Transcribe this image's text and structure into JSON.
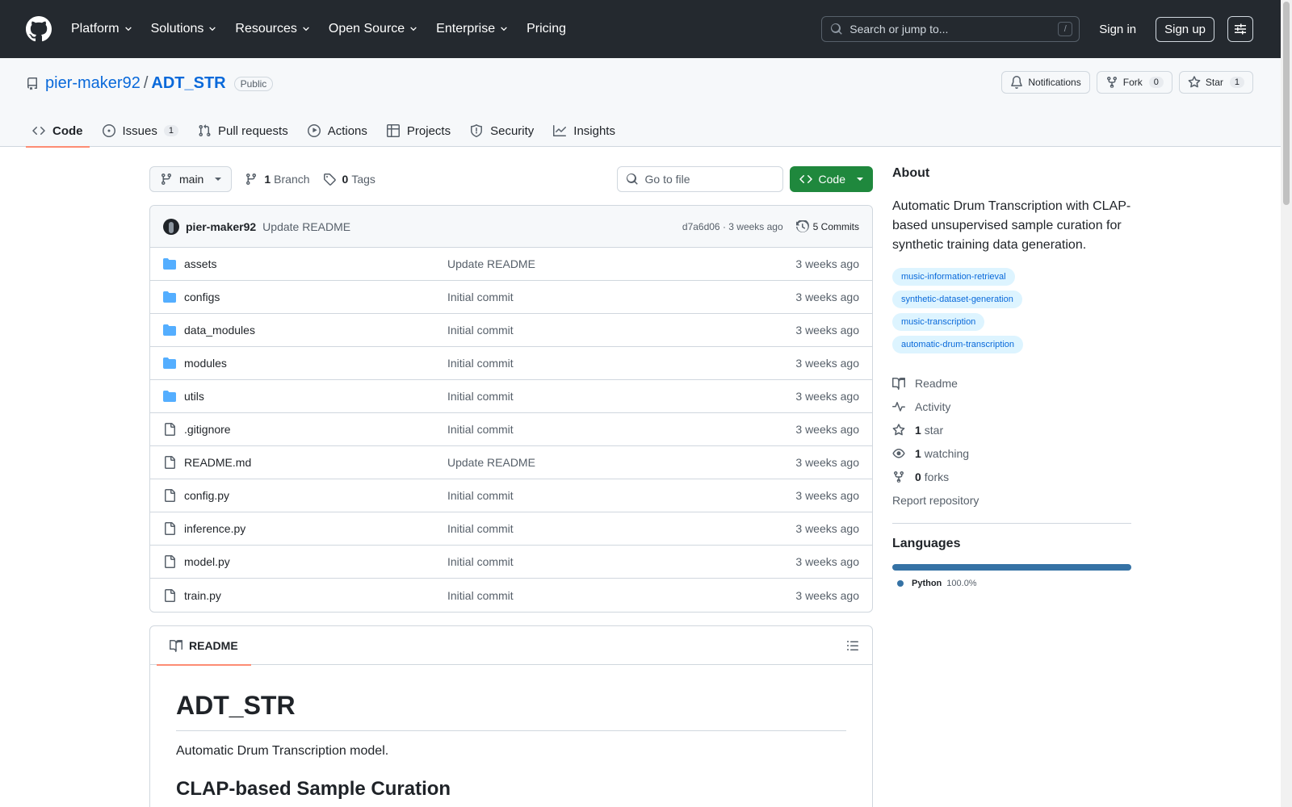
{
  "header": {
    "nav": [
      "Platform",
      "Solutions",
      "Resources",
      "Open Source",
      "Enterprise",
      "Pricing"
    ],
    "search_placeholder": "Search or jump to...",
    "search_shortcut": "/",
    "signin": "Sign in",
    "signup": "Sign up"
  },
  "repo": {
    "owner": "pier-maker92",
    "separator": "/",
    "name": "ADT_STR",
    "visibility": "Public",
    "notifications": "Notifications",
    "fork_label": "Fork",
    "fork_count": "0",
    "star_label": "Star",
    "star_count": "1"
  },
  "tabs": [
    {
      "label": "Code",
      "icon": "code-icon",
      "active": true
    },
    {
      "label": "Issues",
      "icon": "issue-icon",
      "count": "1"
    },
    {
      "label": "Pull requests",
      "icon": "pull-request-icon"
    },
    {
      "label": "Actions",
      "icon": "play-icon"
    },
    {
      "label": "Projects",
      "icon": "table-icon"
    },
    {
      "label": "Security",
      "icon": "shield-icon"
    },
    {
      "label": "Insights",
      "icon": "graph-icon"
    }
  ],
  "filebar": {
    "branch": "main",
    "branch_count": "1",
    "branch_label": "Branch",
    "tag_count": "0",
    "tag_label": "Tags",
    "goto_placeholder": "Go to file",
    "code_button": "Code"
  },
  "latest_commit": {
    "author": "pier-maker92",
    "message": "Update README",
    "meta": "d7a6d06 · 3 weeks ago",
    "commits": "5 Commits"
  },
  "files": [
    {
      "name": "assets",
      "type": "dir",
      "message": "Update README",
      "date": "3 weeks ago"
    },
    {
      "name": "configs",
      "type": "dir",
      "message": "Initial commit",
      "date": "3 weeks ago"
    },
    {
      "name": "data_modules",
      "type": "dir",
      "message": "Initial commit",
      "date": "3 weeks ago"
    },
    {
      "name": "modules",
      "type": "dir",
      "message": "Initial commit",
      "date": "3 weeks ago"
    },
    {
      "name": "utils",
      "type": "dir",
      "message": "Initial commit",
      "date": "3 weeks ago"
    },
    {
      "name": ".gitignore",
      "type": "file",
      "message": "Initial commit",
      "date": "3 weeks ago"
    },
    {
      "name": "README.md",
      "type": "file",
      "message": "Update README",
      "date": "3 weeks ago"
    },
    {
      "name": "config.py",
      "type": "file",
      "message": "Initial commit",
      "date": "3 weeks ago"
    },
    {
      "name": "inference.py",
      "type": "file",
      "message": "Initial commit",
      "date": "3 weeks ago"
    },
    {
      "name": "model.py",
      "type": "file",
      "message": "Initial commit",
      "date": "3 weeks ago"
    },
    {
      "name": "train.py",
      "type": "file",
      "message": "Initial commit",
      "date": "3 weeks ago"
    }
  ],
  "readme": {
    "tab": "README",
    "h1": "ADT_STR",
    "p": "Automatic Drum Transcription model.",
    "h2": "CLAP-based Sample Curation"
  },
  "about": {
    "title": "About",
    "description": "Automatic Drum Transcription with CLAP-based unsupervised sample curation for synthetic training data generation.",
    "topics": [
      "music-information-retrieval",
      "synthetic-dataset-generation",
      "music-transcription",
      "automatic-drum-transcription"
    ],
    "readme": "Readme",
    "activity": "Activity",
    "stars_count": "1",
    "stars_label": "star",
    "watching_count": "1",
    "watching_label": "watching",
    "forks_count": "0",
    "forks_label": "forks",
    "report": "Report repository"
  },
  "languages": {
    "title": "Languages",
    "items": [
      {
        "name": "Python",
        "percent": "100.0%",
        "color": "#3572a5"
      }
    ]
  }
}
